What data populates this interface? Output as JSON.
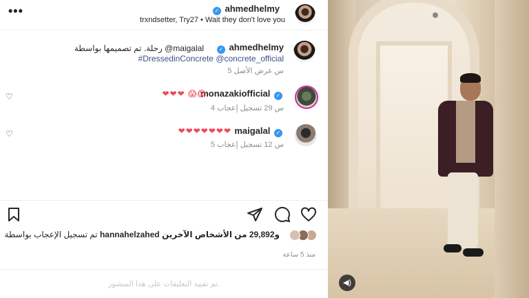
{
  "header": {
    "more_label": "•••",
    "username": "ahmedhelmy",
    "subtitle": "trxndsetter, Try27 • Wait they don't love you"
  },
  "caption": {
    "username": "ahmedhelmy",
    "text_line1": "رحلة. تم تصميمها بواسطة @maigalal",
    "text_line2": "#DressedinConcrete @concrete_official",
    "meta": "5 س    عرض الأصل"
  },
  "comments": [
    {
      "username": "monazakiofficial",
      "text": "❤❤❤ 😱😱",
      "meta": "4 س    29 تسجيل إعجاب"
    },
    {
      "username": "maigalal",
      "text": "❤❤❤❤❤❤❤",
      "meta": "5 س    12 تسجيل إعجاب"
    }
  ],
  "likes": {
    "text_prefix": "تم تسجيل الإعجاب بواسطة",
    "liker": "hannahelzahed",
    "text_suffix": "و29,892 من الأشخاص الآخرين"
  },
  "time_ago": "منذ 5 ساعة",
  "comments_closed": "تم تقييد التعليقات على هذا المنشور.",
  "icons": {
    "more": "more-dots-icon",
    "like": "heart-icon",
    "comment": "comment-icon",
    "share": "share-icon",
    "save": "bookmark-icon",
    "sound": "volume-icon"
  },
  "colors": {
    "verified": "#3897f0",
    "heart": "#ed4956",
    "link": "#385185",
    "muted": "#8e8e8e"
  }
}
